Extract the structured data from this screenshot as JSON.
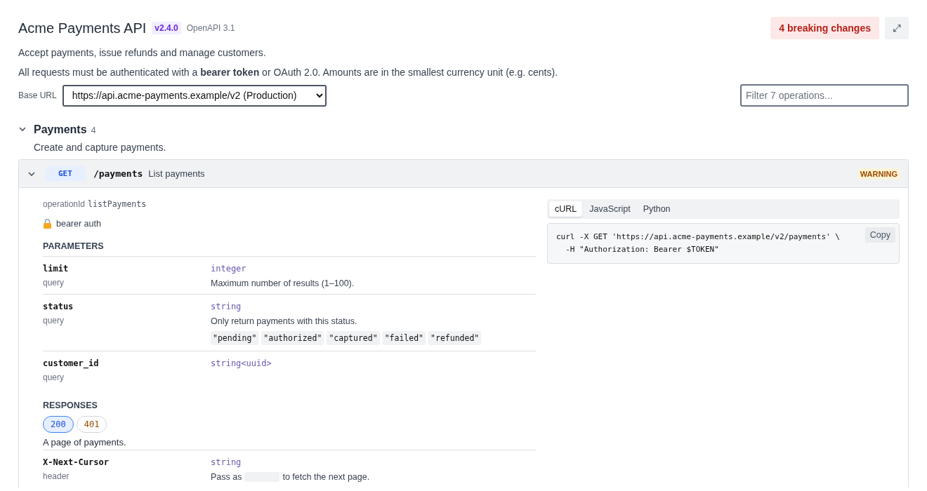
{
  "header": {
    "title": "Acme Payments API",
    "version": "v2.4.0",
    "spec": "OpenAPI 3.1",
    "breaking": "4 breaking changes",
    "expand_icon": "⤢"
  },
  "description": [
    "Accept payments, issue refunds and manage customers.",
    "All requests must be authenticated with a **bearer token** or OAuth 2.0. Amounts are in the smallest currency unit (e.g. cents)."
  ],
  "base_url": {
    "label": "Base URL",
    "value": "https://api.acme-payments.example/v2 (Production)"
  },
  "filter": {
    "placeholder": "Filter 7 operations..."
  },
  "groups": [
    {
      "name": "Payments",
      "count": "4",
      "expanded": true,
      "description": "Create and capture payments.",
      "operations": [
        {
          "method": "GET",
          "path": "/payments",
          "summary": "List payments",
          "badge": "WARNING",
          "expanded": true,
          "operation_id_label": "operationId",
          "operation_id": "listPayments",
          "auth": "bearer auth",
          "parameters_title": "PARAMETERS",
          "parameters": [
            {
              "name": "limit",
              "location": "query",
              "type": "integer",
              "description": "Maximum number of results (1–100)."
            },
            {
              "name": "status",
              "location": "query",
              "type": "string",
              "description": "Only return payments with this status.",
              "enum": [
                "\"pending\"",
                "\"authorized\"",
                "\"captured\"",
                "\"failed\"",
                "\"refunded\""
              ]
            },
            {
              "name": "customer_id",
              "location": "query",
              "type": "string<uuid>"
            }
          ],
          "responses_title": "RESPONSES",
          "responses": [
            {
              "code": "200",
              "kind": "success",
              "selected": true
            },
            {
              "code": "401",
              "kind": "error",
              "selected": false
            }
          ],
          "response_description": "A page of payments.",
          "headers": [
            {
              "name": "X-Next-Cursor",
              "location": "header",
              "type": "string",
              "description_before": "Pass as",
              "description_after": "to fetch the next page."
            }
          ],
          "code_tabs": [
            {
              "label": "cURL",
              "selected": true
            },
            {
              "label": "JavaScript",
              "selected": false
            },
            {
              "label": "Python",
              "selected": false
            }
          ],
          "code_lines": [
            "curl -X GET 'https://api.acme-payments.example/v2/payments' \\",
            "  -H \"Authorization: Bearer $TOKEN\""
          ],
          "copy": "Copy"
        }
      ]
    }
  ]
}
